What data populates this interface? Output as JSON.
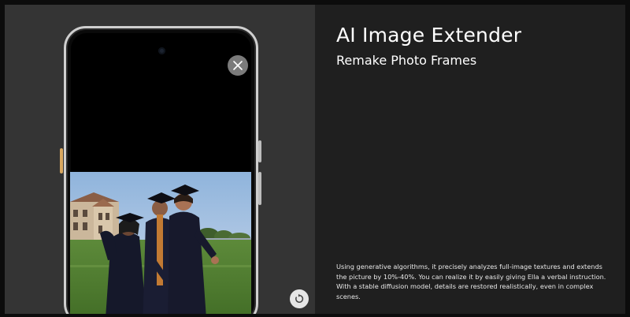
{
  "feature": {
    "title": "AI Image Extender",
    "subtitle": "Remake Photo Frames",
    "description": "Using generative algorithms, it precisely analyzes full-image textures and extends the picture by 10%-40%. You can realize it by easily giving Ella a verbal instruction. With a stable diffusion model, details are restored realistically, even in complex scenes."
  },
  "phone": {
    "close_icon": "close-icon",
    "redo_icon": "redo-icon",
    "photo_subject": "graduation-photo"
  },
  "colors": {
    "panel_left": "#343434",
    "panel_right": "#1f1f1f",
    "text": "#ffffff",
    "phone_frame": "#cfcfcf",
    "side_button_accent": "#d9a860"
  }
}
